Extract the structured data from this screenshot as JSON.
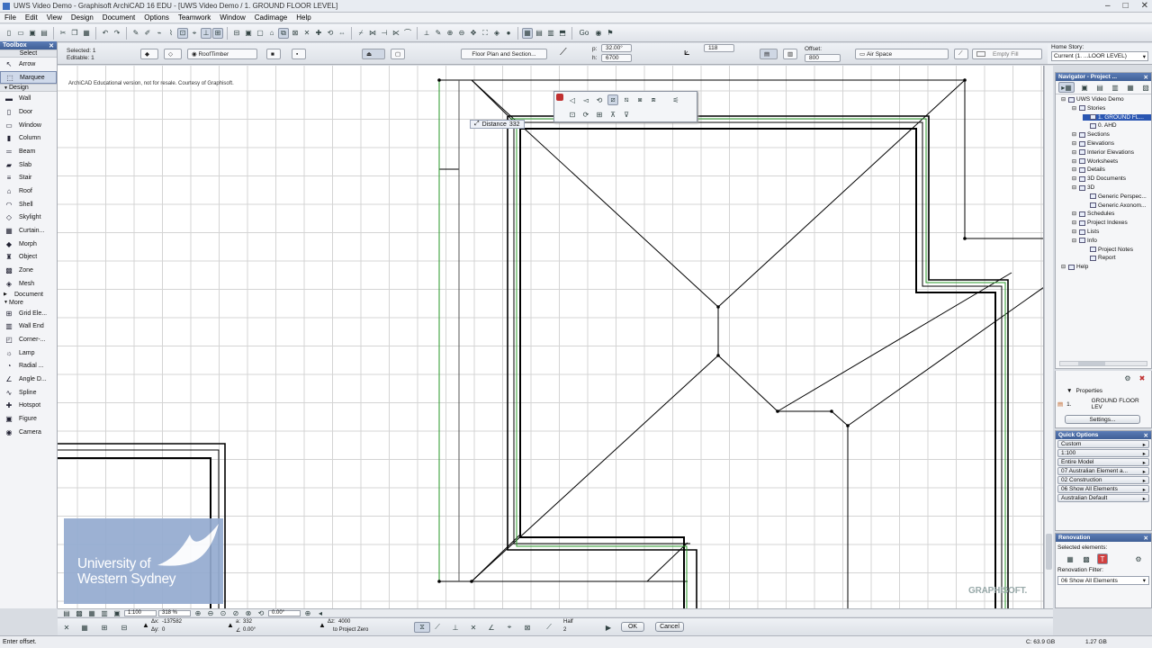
{
  "window": {
    "title": "UWS Video Demo - Graphisoft ArchiCAD 16 EDU - [UWS Video Demo / 1. GROUND FLOOR LEVEL]"
  },
  "menu": [
    "File",
    "Edit",
    "View",
    "Design",
    "Document",
    "Options",
    "Teamwork",
    "Window",
    "Cadimage",
    "Help"
  ],
  "infobox": {
    "selected_label": "Selected: 1",
    "editable_label": "Editable: 1",
    "roof_type": "RoofTimber",
    "floorplan": "Floor Plan and Section...",
    "pitch_label": "p:",
    "pitch_value": "32.00°",
    "height_label": "h:",
    "height_value": "6700",
    "thickness": "118",
    "offset_label": "Offset:",
    "offset_value": "800",
    "air_space": "Air Space",
    "empty_fill": "Empty Fill"
  },
  "homestory": {
    "label": "Home Story:",
    "value": "Current (1. ...LOOR LEVEL)"
  },
  "toolbox": {
    "title": "Toolbox",
    "select_label": "Select",
    "select_items": [
      {
        "icon": "arrow-icon",
        "label": "Arrow"
      },
      {
        "icon": "marquee-icon",
        "label": "Marquee"
      }
    ],
    "design_label": "Design",
    "design_items": [
      {
        "icon": "wall-icon",
        "label": "Wall"
      },
      {
        "icon": "door-icon",
        "label": "Door"
      },
      {
        "icon": "window-icon",
        "label": "Window"
      },
      {
        "icon": "column-icon",
        "label": "Column"
      },
      {
        "icon": "beam-icon",
        "label": "Beam"
      },
      {
        "icon": "slab-icon",
        "label": "Slab"
      },
      {
        "icon": "stair-icon",
        "label": "Stair"
      },
      {
        "icon": "roof-icon",
        "label": "Roof"
      },
      {
        "icon": "shell-icon",
        "label": "Shell"
      },
      {
        "icon": "skylight-icon",
        "label": "Skylight"
      },
      {
        "icon": "curtain-wall-icon",
        "label": "Curtain..."
      },
      {
        "icon": "morph-icon",
        "label": "Morph"
      },
      {
        "icon": "object-icon",
        "label": "Object"
      },
      {
        "icon": "zone-icon",
        "label": "Zone"
      },
      {
        "icon": "mesh-icon",
        "label": "Mesh"
      }
    ],
    "document_label": "Document",
    "more_label": "More",
    "more_items": [
      {
        "icon": "grid-element-icon",
        "label": "Grid Ele..."
      },
      {
        "icon": "wall-end-icon",
        "label": "Wall End"
      },
      {
        "icon": "corner-window-icon",
        "label": "Corner-..."
      },
      {
        "icon": "lamp-icon",
        "label": "Lamp"
      },
      {
        "icon": "radial-dimension-icon",
        "label": "Radial ..."
      },
      {
        "icon": "angle-dimension-icon",
        "label": "Angle D..."
      },
      {
        "icon": "spline-icon",
        "label": "Spline"
      },
      {
        "icon": "hotspot-icon",
        "label": "Hotspot"
      },
      {
        "icon": "figure-icon",
        "label": "Figure"
      },
      {
        "icon": "camera-icon",
        "label": "Camera"
      }
    ]
  },
  "canvas": {
    "watermark": "ArchiCAD Educational version, not for resale. Courtesy of Graphisoft.",
    "distance_label": "Distance",
    "distance_value": "332",
    "logo_text_1": "University of",
    "logo_text_2": "Western Sydney",
    "brand": "GRAPHISOFT."
  },
  "bottombar": {
    "scale": "1:100",
    "zoom": "318 %",
    "angle": "0.00°"
  },
  "tracker": {
    "dx_label": "Δx:",
    "dx_value": "-137582",
    "dy_label": "Δy:",
    "dy_value": "0",
    "a_label": "a:",
    "a_value": "332",
    "angle_label": "∠",
    "angle_value": "0.00°",
    "dist_label": "Δz:",
    "dist_value": "4000",
    "to_label": "to Project Zero",
    "half_label": "Half",
    "half_value": "2",
    "ok_label": "OK",
    "cancel_label": "Cancel"
  },
  "status": {
    "left": "Enter offset.",
    "disk_c": "C: 63.9 GB",
    "disk_ram": "1.27 GB"
  },
  "navigator": {
    "title": "Navigator - Project ...",
    "tree": [
      {
        "label": "UWS Video Demo",
        "level": 0
      },
      {
        "label": "Stories",
        "level": 1
      },
      {
        "label": "1. GROUND FL...",
        "level": 2,
        "selected": true
      },
      {
        "label": "0. AHD",
        "level": 2
      },
      {
        "label": "Sections",
        "level": 1
      },
      {
        "label": "Elevations",
        "level": 1
      },
      {
        "label": "Interior Elevations",
        "level": 1
      },
      {
        "label": "Worksheets",
        "level": 1
      },
      {
        "label": "Details",
        "level": 1
      },
      {
        "label": "3D Documents",
        "level": 1
      },
      {
        "label": "3D",
        "level": 1
      },
      {
        "label": "Generic Perspec...",
        "level": 2
      },
      {
        "label": "Generic Axonom...",
        "level": 2
      },
      {
        "label": "Schedules",
        "level": 1
      },
      {
        "label": "Project Indexes",
        "level": 1
      },
      {
        "label": "Lists",
        "level": 1
      },
      {
        "label": "Info",
        "level": 1
      },
      {
        "label": "Project Notes",
        "level": 2
      },
      {
        "label": "Report",
        "level": 2
      },
      {
        "label": "Help",
        "level": 0
      }
    ]
  },
  "properties": {
    "title": "Properties",
    "num": "1.",
    "name": "GROUND FLOOR LEV",
    "settings": "Settings..."
  },
  "quick_options": {
    "title": "Quick Options",
    "items": [
      "Custom",
      "1:100",
      "Entire Model",
      "07 Australian Element a...",
      "02 Construction",
      "06 Show All Elements",
      "Australian Default"
    ]
  },
  "renovation": {
    "title": "Renovation",
    "selected_label": "Selected elements:",
    "filter_label": "Renovation Filter:",
    "filter_value": "06 Show All Elements"
  }
}
